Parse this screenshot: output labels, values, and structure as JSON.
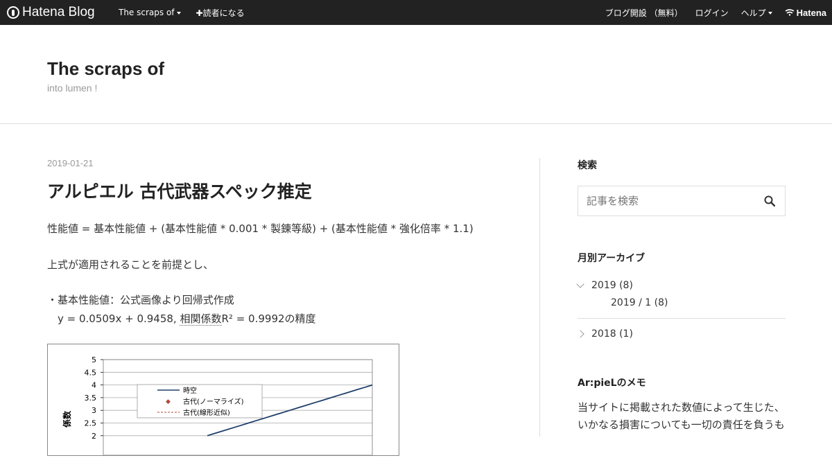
{
  "globalheader": {
    "logo_text": "Hatena Blog",
    "blog_menu": "The scraps of",
    "subscribe": "✚読者になる",
    "open_blog": "ブログ開設 （無料）",
    "login": "ログイン",
    "help": "ヘルプ",
    "hatena": "Hatena"
  },
  "blog": {
    "title": "The scraps of",
    "description": "into lumen !"
  },
  "entry": {
    "date": "2019-01-21",
    "title": "アルピエル 古代武器スペック推定",
    "formula": "性能値 = 基本性能値 + (基本性能値 * 0.001 * 製錬等級) + (基本性能値 * 強化倍率 * 1.1)",
    "premise": "上式が適用されることを前提とし、",
    "bullet1": "・基本性能値：公式画像より回帰式作成",
    "regression": "y = 0.0509x + 0.9458, ",
    "regression_link": "相関係数",
    "regression_tail": "R² = 0.9992の精度"
  },
  "chart_data": {
    "type": "line",
    "ylim": [
      0,
      5
    ],
    "yticks": [
      "5",
      "4.5",
      "4",
      "3.5",
      "3",
      "2.5",
      "2"
    ],
    "ylabel": "係数",
    "series": [
      {
        "name": "時空",
        "color": "#1f3d6b"
      },
      {
        "name": "古代(ノーマライズ)",
        "color": "#b0483a"
      },
      {
        "name": "古代(線形近似)",
        "color": "#b0483a"
      }
    ]
  },
  "sidebar": {
    "search_heading": "検索",
    "search_placeholder": "記事を検索",
    "archive_heading": "月別アーカイブ",
    "year_2019": "2019 (8)",
    "month_2019_1": "2019 / 1 (8)",
    "year_2018": "2018 (1)",
    "memo_heading": "Ar:pieLのメモ",
    "memo_line1": "当サイトに掲載された数値によって生じた、",
    "memo_line2": "いかなる損害についても一切の責任を負うも"
  }
}
